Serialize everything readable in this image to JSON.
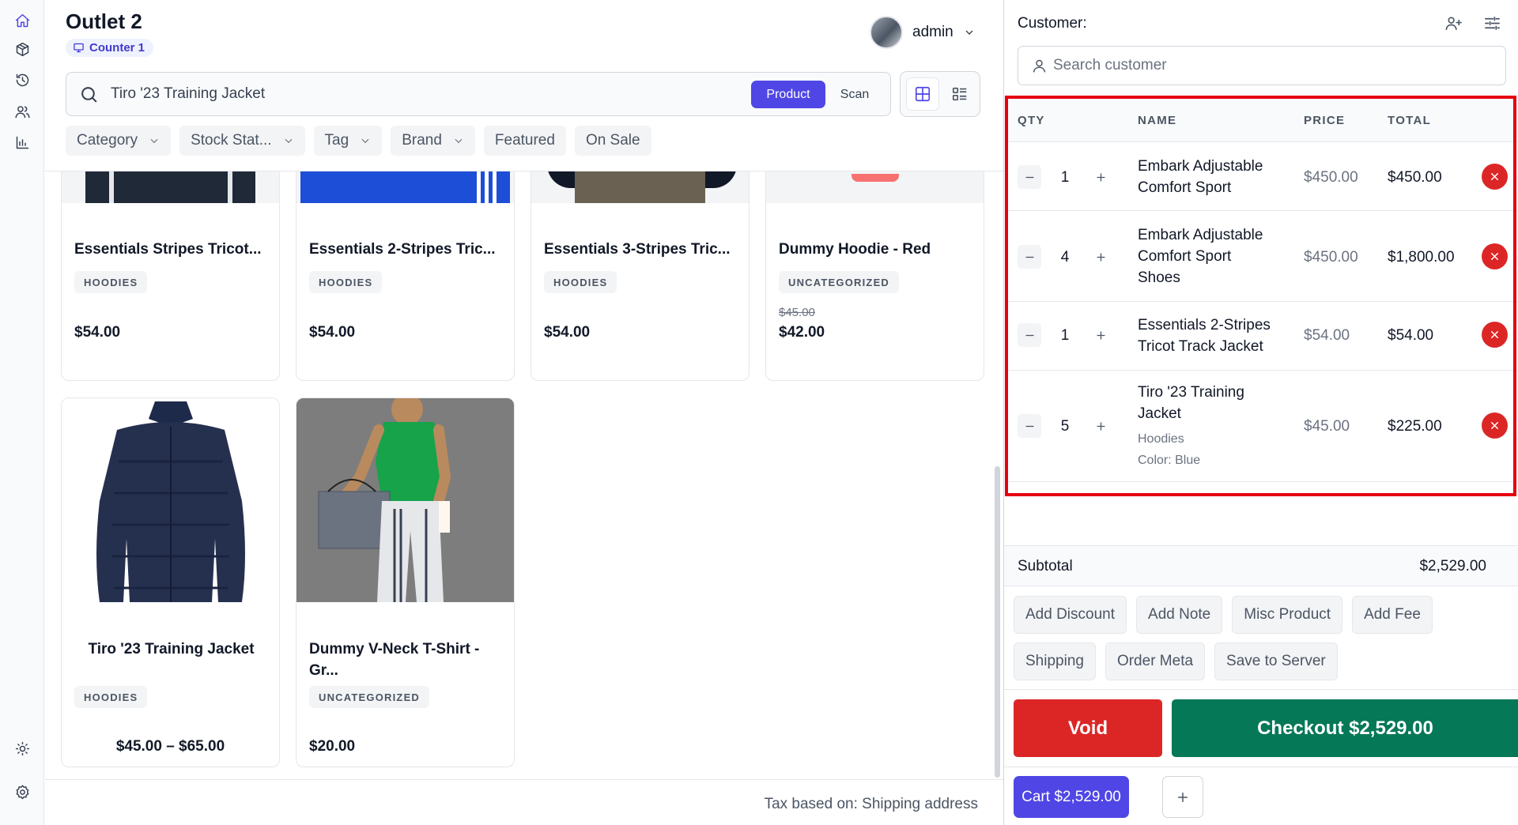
{
  "header": {
    "outlet": "Outlet 2",
    "counter": "Counter 1",
    "user": "admin"
  },
  "search": {
    "value": "Tiro '23 Training Jacket",
    "mode_product": "Product",
    "mode_scan": "Scan"
  },
  "filters": [
    "Category",
    "Stock Stat...",
    "Tag",
    "Brand",
    "Featured",
    "On Sale"
  ],
  "products": [
    {
      "name": "Essentials Stripes Tricot...",
      "category": "HOODIES",
      "price": "$54.00"
    },
    {
      "name": "Essentials 2-Stripes Tric...",
      "category": "HOODIES",
      "price": "$54.00"
    },
    {
      "name": "Essentials 3-Stripes Tric...",
      "category": "HOODIES",
      "price": "$54.00"
    },
    {
      "name": "Dummy Hoodie - Red",
      "category": "UNCATEGORIZED",
      "old_price": "$45.00",
      "price": "$42.00"
    },
    {
      "name": "Tiro '23 Training Jacket",
      "category": "HOODIES",
      "price": "$45.00 – $65.00"
    },
    {
      "name": "Dummy V-Neck T-Shirt - Gr...",
      "category": "UNCATEGORIZED",
      "price": "$20.00"
    }
  ],
  "footer": {
    "tax_note": "Tax based on: Shipping address"
  },
  "cart": {
    "customer_label": "Customer:",
    "customer_placeholder": "Search customer",
    "columns": [
      "QTY",
      "NAME",
      "PRICE",
      "TOTAL"
    ],
    "items": [
      {
        "qty": "1",
        "name": "Embark Adjustable Comfort Sport",
        "price": "$450.00",
        "total": "$450.00"
      },
      {
        "qty": "4",
        "name": "Embark Adjustable Comfort Sport Shoes",
        "price": "$450.00",
        "total": "$1,800.00"
      },
      {
        "qty": "1",
        "name": "Essentials 2-Stripes Tricot Track Jacket",
        "price": "$54.00",
        "total": "$54.00"
      },
      {
        "qty": "5",
        "name": "Tiro '23 Training Jacket",
        "category": "Hoodies",
        "attribute": "Color: Blue",
        "price": "$45.00",
        "total": "$225.00"
      }
    ],
    "subtotal_label": "Subtotal",
    "subtotal": "$2,529.00",
    "actions_row1": [
      "Add Discount",
      "Add Note",
      "Misc Product",
      "Add Fee"
    ],
    "actions_row2": [
      "Shipping",
      "Order Meta",
      "Save to Server"
    ],
    "void_label": "Void",
    "checkout_label": "Checkout $2,529.00",
    "cart_tab": "Cart $2,529.00"
  },
  "colors": {
    "accent": "#4f46e5",
    "danger": "#dc2626",
    "success": "#047857",
    "highlight": "#e5000f"
  }
}
